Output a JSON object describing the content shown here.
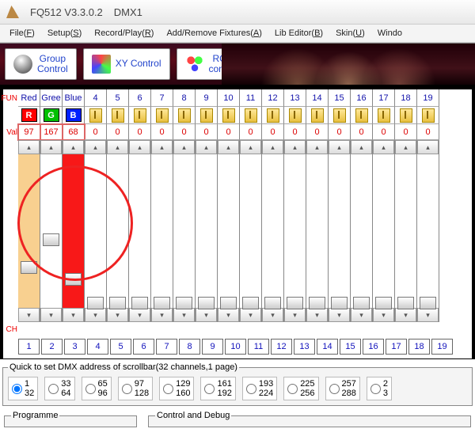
{
  "title": {
    "app": "FQ512 V3.3.0.2",
    "doc": "DMX1"
  },
  "menu": {
    "file": "File",
    "setup": "Setup",
    "record": "Record/Play",
    "fixtures": "Add/Remove Fixtures",
    "lib": "Lib Editor",
    "skin": "Skin",
    "window": "Windo"
  },
  "toolbar": {
    "group": "Group\nControl",
    "xy": "XY Control",
    "rgb": "RGB\ncontrol"
  },
  "rowlabels": {
    "fun": "FUN",
    "val": "Val",
    "ch": "CH"
  },
  "fun": [
    "Red",
    "Gree",
    "Blue",
    "4",
    "5",
    "6",
    "7",
    "8",
    "9",
    "10",
    "11",
    "12",
    "13",
    "14",
    "15",
    "16",
    "17",
    "18",
    "19"
  ],
  "rgb": {
    "r": "R",
    "g": "G",
    "b": "B",
    "rc": "#ff0000",
    "gc": "#00c000",
    "bc": "#0020ff"
  },
  "val": [
    "97",
    "167",
    "68",
    "0",
    "0",
    "0",
    "0",
    "0",
    "0",
    "0",
    "0",
    "0",
    "0",
    "0",
    "0",
    "0",
    "0",
    "0",
    "0"
  ],
  "thumbpos": [
    135,
    100,
    150,
    180,
    180,
    180,
    180,
    180,
    180,
    180,
    180,
    180,
    180,
    180,
    180,
    180,
    180,
    180,
    180
  ],
  "ch": [
    "1",
    "2",
    "3",
    "4",
    "5",
    "6",
    "7",
    "8",
    "9",
    "10",
    "11",
    "12",
    "13",
    "14",
    "15",
    "16",
    "17",
    "18",
    "19"
  ],
  "quick": {
    "legend": "Quick to set DMX address of scrollbar(32 channels,1 page)",
    "ranges": [
      [
        "1",
        "32"
      ],
      [
        "33",
        "64"
      ],
      [
        "65",
        "96"
      ],
      [
        "97",
        "128"
      ],
      [
        "129",
        "160"
      ],
      [
        "161",
        "192"
      ],
      [
        "193",
        "224"
      ],
      [
        "225",
        "256"
      ],
      [
        "257",
        "288"
      ],
      [
        "2",
        "3"
      ]
    ]
  },
  "panels": {
    "prog": "Programme",
    "ctrl": "Control and Debug"
  }
}
